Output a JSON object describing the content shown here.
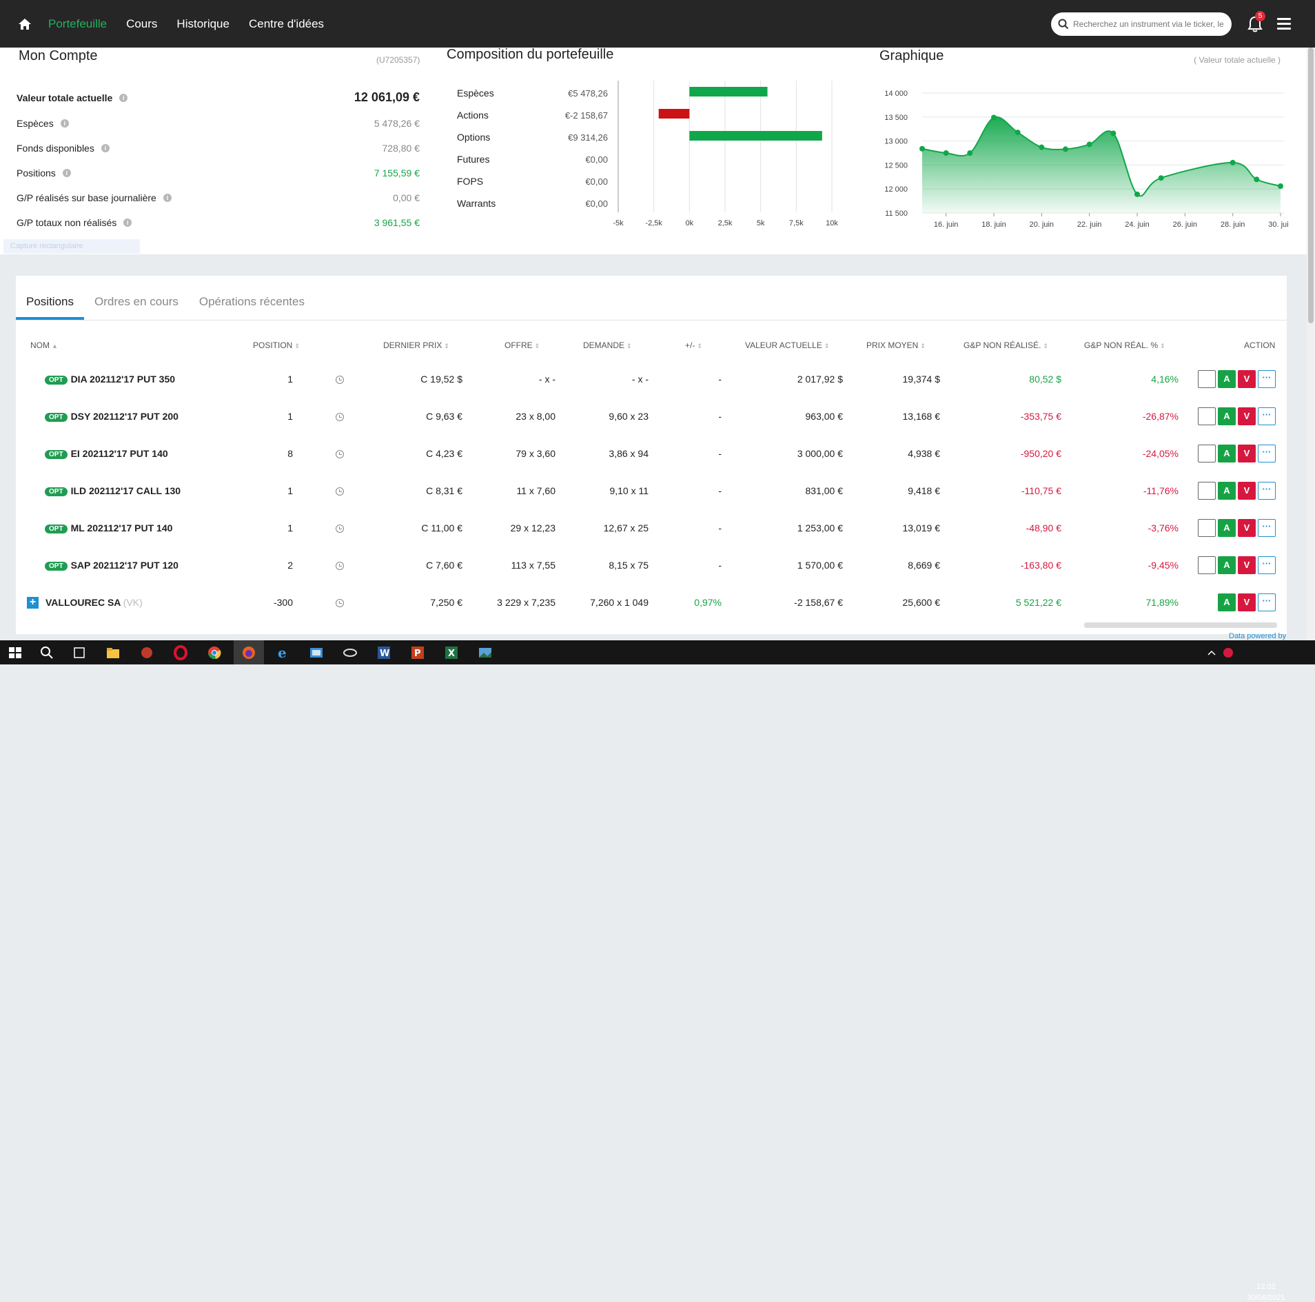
{
  "nav": {
    "items": [
      "Portefeuille",
      "Cours",
      "Historique",
      "Centre d'idées"
    ],
    "search_placeholder": "Recherchez un instrument via le ticker, le",
    "notif_count": "5"
  },
  "account": {
    "title": "Mon Compte",
    "id": "(U7205357)",
    "rows": [
      {
        "label": "Valeur totale actuelle",
        "value": "12 061,09 €"
      },
      {
        "label": "Espèces",
        "value": "5 478,26 €"
      },
      {
        "label": "Fonds disponibles",
        "value": "728,80 €"
      },
      {
        "label": "Positions",
        "value": "7 155,59 €"
      },
      {
        "label": "G/P réalisés sur base journalière",
        "value": "0,00 €"
      },
      {
        "label": "G/P totaux non réalisés",
        "value": "3 961,55 €"
      }
    ],
    "ghost": "Capture rectangulaire"
  },
  "composition": {
    "title": "Composition du portefeuille",
    "items": [
      {
        "label": "Espèces",
        "value": "€5 478,26"
      },
      {
        "label": "Actions",
        "value": "€-2 158,67"
      },
      {
        "label": "Options",
        "value": "€9 314,26"
      },
      {
        "label": "Futures",
        "value": "€0,00"
      },
      {
        "label": "FOPS",
        "value": "€0,00"
      },
      {
        "label": "Warrants",
        "value": "€0,00"
      }
    ]
  },
  "graph": {
    "title": "Graphique",
    "subtitle": "( Valeur totale actuelle )"
  },
  "chart_data": [
    {
      "type": "bar",
      "orientation": "horizontal",
      "categories": [
        "Espèces",
        "Actions",
        "Options",
        "Futures",
        "FOPS",
        "Warrants"
      ],
      "values": [
        5478.26,
        -2158.67,
        9314.26,
        0,
        0,
        0
      ],
      "xlim": [
        -5000,
        10000
      ],
      "ticks": [
        "-5k",
        "-2,5k",
        "0k",
        "2,5k",
        "5k",
        "7,5k",
        "10k"
      ],
      "tick_values": [
        -5000,
        -2500,
        0,
        2500,
        5000,
        7500,
        10000
      ],
      "colors": {
        "positive": "#10a74a",
        "negative": "#cc1116"
      },
      "grid": true
    },
    {
      "type": "area",
      "x": [
        "15 juin",
        "16 juin",
        "17 juin",
        "18 juin",
        "19 juin",
        "20 juin",
        "21 juin",
        "22 juin",
        "23 juin",
        "24 juin",
        "25 juin",
        "28 juin",
        "29 juin",
        "30 juin"
      ],
      "x_index": [
        0,
        1,
        2,
        3,
        4,
        5,
        6,
        7,
        8,
        9,
        10,
        13,
        14,
        15
      ],
      "values": [
        12840,
        12750,
        12750,
        13490,
        13180,
        12870,
        12830,
        12930,
        13160,
        11890,
        12230,
        12550,
        12200,
        12060
      ],
      "ylim": [
        11500,
        14000
      ],
      "yticks": [
        "14 000",
        "13 500",
        "13 000",
        "12 500",
        "12 000",
        "11 500"
      ],
      "ytick_values": [
        14000,
        13500,
        13000,
        12500,
        12000,
        11500
      ],
      "xticks": [
        "16. juin",
        "18. juin",
        "20. juin",
        "22. juin",
        "24. juin",
        "26. juin",
        "28. juin",
        "30. juin"
      ],
      "xtick_index": [
        1,
        3,
        5,
        7,
        9,
        11,
        13,
        15
      ],
      "color": "#10a74a",
      "grid": true
    }
  ],
  "tabs": [
    "Positions",
    "Ordres en cours",
    "Opérations récentes"
  ],
  "headers": [
    "NOM",
    "POSITION",
    "DERNIER PRIX",
    "OFFRE",
    "DEMANDE",
    "+/-",
    "VALEUR ACTUELLE",
    "PRIX MOYEN",
    "G&P NON RÉALISÉ.",
    "G&P NON RÉAL. %",
    "ACTION"
  ],
  "rows": [
    {
      "badge": "OPT",
      "name": "DIA 202112'17 PUT 350",
      "pos": "1",
      "last": "C 19,52 $",
      "bid": "- x -",
      "ask": "- x -",
      "chg": "-",
      "value": "2 017,92 $",
      "avg": "19,374 $",
      "pnl": "80,52 $",
      "pnlp": "4,16%"
    },
    {
      "badge": "OPT",
      "name": "DSY 202112'17 PUT 200",
      "pos": "1",
      "last": "C 9,63 €",
      "bid": "23 x 8,00",
      "ask": "9,60 x 23",
      "chg": "-",
      "value": "963,00 €",
      "avg": "13,168 €",
      "pnl": "-353,75 €",
      "pnlp": "-26,87%"
    },
    {
      "badge": "OPT",
      "name": "EI 202112'17 PUT 140",
      "pos": "8",
      "last": "C 4,23 €",
      "bid": "79 x 3,60",
      "ask": "3,86 x 94",
      "chg": "-",
      "value": "3 000,00 €",
      "avg": "4,938 €",
      "pnl": "-950,20 €",
      "pnlp": "-24,05%"
    },
    {
      "badge": "OPT",
      "name": "ILD 202112'17 CALL 130",
      "pos": "1",
      "last": "C 8,31 €",
      "bid": "11 x 7,60",
      "ask": "9,10 x 11",
      "chg": "-",
      "value": "831,00 €",
      "avg": "9,418 €",
      "pnl": "-110,75 €",
      "pnlp": "-11,76%"
    },
    {
      "badge": "OPT",
      "name": "ML 202112'17 PUT 140",
      "pos": "1",
      "last": "C 11,00 €",
      "bid": "29 x 12,23",
      "ask": "12,67 x 25",
      "chg": "-",
      "value": "1 253,00 €",
      "avg": "13,019 €",
      "pnl": "-48,90 €",
      "pnlp": "-3,76%"
    },
    {
      "badge": "OPT",
      "name": "SAP 202112'17 PUT 120",
      "pos": "2",
      "last": "C 7,60 €",
      "bid": "113 x 7,55",
      "ask": "8,15 x 75",
      "chg": "-",
      "value": "1 570,00 €",
      "avg": "8,669 €",
      "pnl": "-163,80 €",
      "pnlp": "-9,45%"
    },
    {
      "badge": "",
      "name": "VALLOUREC SA",
      "ticker": "(VK)",
      "pos": "-300",
      "last": "7,250 €",
      "bid": "3 229 x 7,235",
      "ask": "7,260 x 1 049",
      "chg": "0,97%",
      "value": "-2 158,67 €",
      "avg": "25,600 €",
      "pnl": "5 521,22 €",
      "pnlp": "71,89%"
    }
  ],
  "actions": {
    "buy": "A",
    "sell": "V",
    "more": "···"
  },
  "footer": {
    "powered": "Data powered by",
    "time": "12:02",
    "date": "30/06/2021"
  }
}
